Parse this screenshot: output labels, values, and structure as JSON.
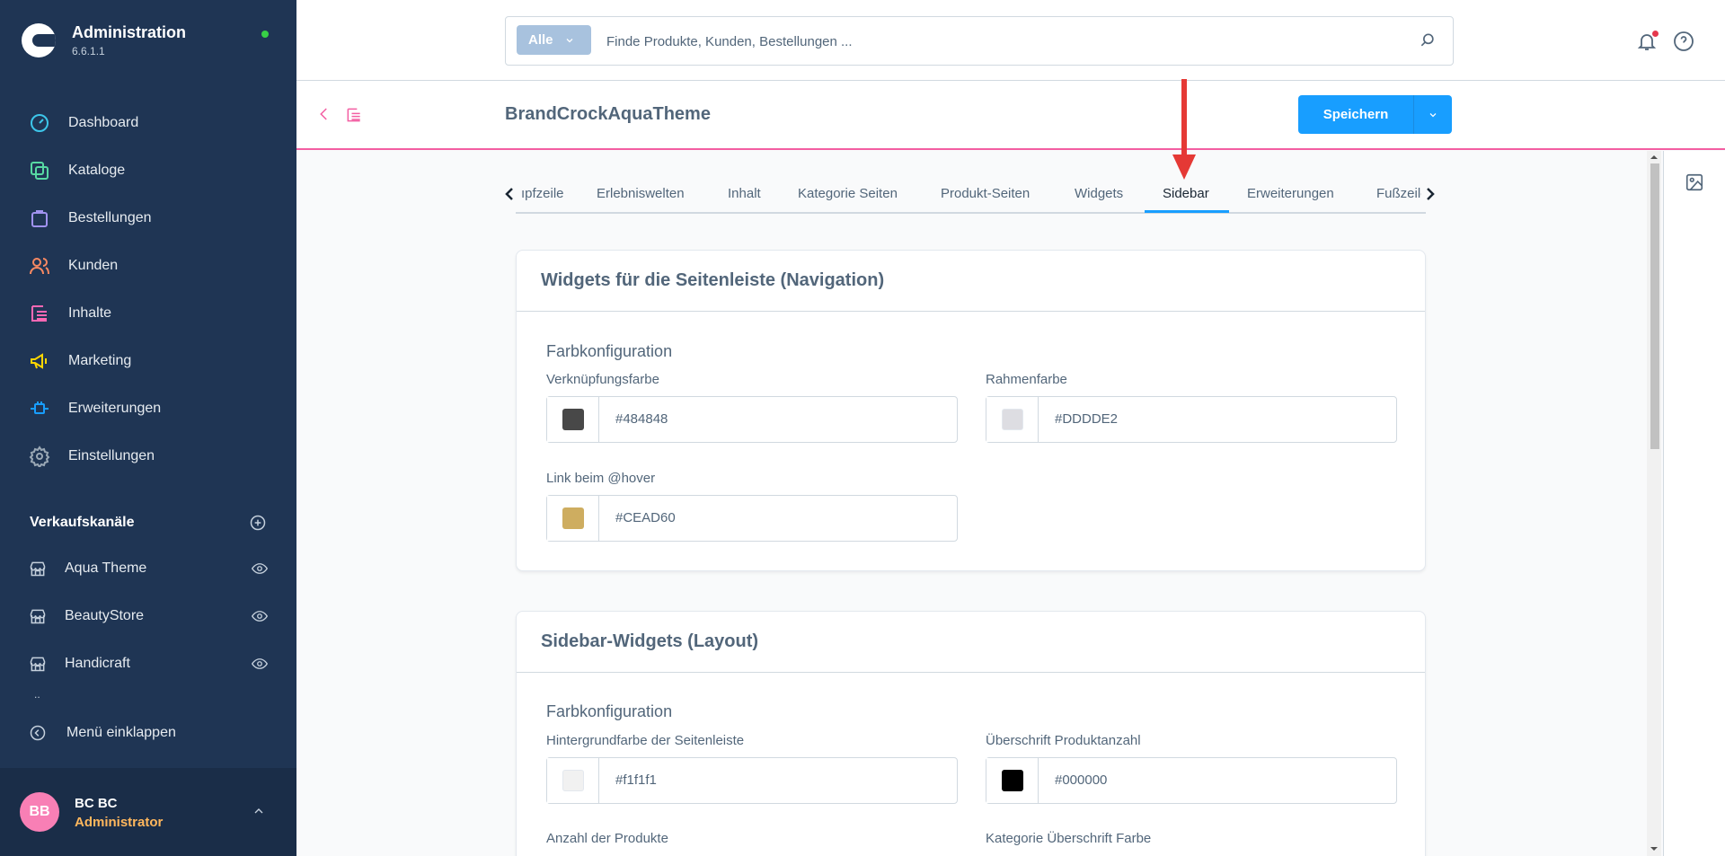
{
  "app": {
    "title": "Administration",
    "version": "6.6.1.1"
  },
  "nav": {
    "items": [
      {
        "label": "Dashboard",
        "icon": "gauge-icon",
        "color": "#3dc6ea"
      },
      {
        "label": "Kataloge",
        "icon": "catalog-icon",
        "color": "#57d9a3"
      },
      {
        "label": "Bestellungen",
        "icon": "shopping-bag-icon",
        "color": "#a092f0"
      },
      {
        "label": "Kunden",
        "icon": "users-icon",
        "color": "#f88962"
      },
      {
        "label": "Inhalte",
        "icon": "content-icon",
        "color": "#ff68b4"
      },
      {
        "label": "Marketing",
        "icon": "megaphone-icon",
        "color": "#ffd700"
      },
      {
        "label": "Erweiterungen",
        "icon": "plug-icon",
        "color": "#189eff"
      },
      {
        "label": "Einstellungen",
        "icon": "gear-icon",
        "color": "#9aa8b5"
      }
    ]
  },
  "channels": {
    "title": "Verkaufskanäle",
    "items": [
      {
        "label": "Aqua Theme"
      },
      {
        "label": "BeautyStore"
      },
      {
        "label": "Handicraft"
      }
    ],
    "more": ".."
  },
  "collapse_label": "Menü einklappen",
  "user": {
    "initials": "BB",
    "name": "BC BC",
    "role": "Administrator"
  },
  "search": {
    "type_label": "Alle",
    "placeholder": "Finde Produkte, Kunden, Bestellungen ..."
  },
  "page": {
    "title": "BrandCrockAquaTheme",
    "save_label": "Speichern"
  },
  "tabs": [
    {
      "label": "ıpfzeile"
    },
    {
      "label": "Erlebniswelten"
    },
    {
      "label": "Inhalt"
    },
    {
      "label": "Kategorie Seiten"
    },
    {
      "label": "Produkt-Seiten"
    },
    {
      "label": "Widgets"
    },
    {
      "label": "Sidebar",
      "active": true
    },
    {
      "label": "Erweiterungen"
    },
    {
      "label": "Fußzeile"
    }
  ],
  "cards": [
    {
      "title": "Widgets für die Seitenleiste (Navigation)",
      "section": "Farbkonfiguration",
      "fields": [
        {
          "label": "Verknüpfungsfarbe",
          "value": "#484848",
          "swatch": "#484848"
        },
        {
          "label": "Rahmenfarbe",
          "value": "#DDDDE2",
          "swatch": "#DDDDE2"
        },
        {
          "label": "Link beim @hover",
          "value": "#CEAD60",
          "swatch": "#CEAD60"
        }
      ]
    },
    {
      "title": "Sidebar-Widgets (Layout)",
      "section": "Farbkonfiguration",
      "fields": [
        {
          "label": "Hintergrundfarbe der Seitenleiste",
          "value": "#f1f1f1",
          "swatch": "#f1f1f1"
        },
        {
          "label": "Überschrift Produktanzahl",
          "value": "#000000",
          "swatch": "#000000"
        },
        {
          "label": "Anzahl der Produkte"
        },
        {
          "label": "Kategorie Überschrift Farbe"
        }
      ]
    }
  ]
}
